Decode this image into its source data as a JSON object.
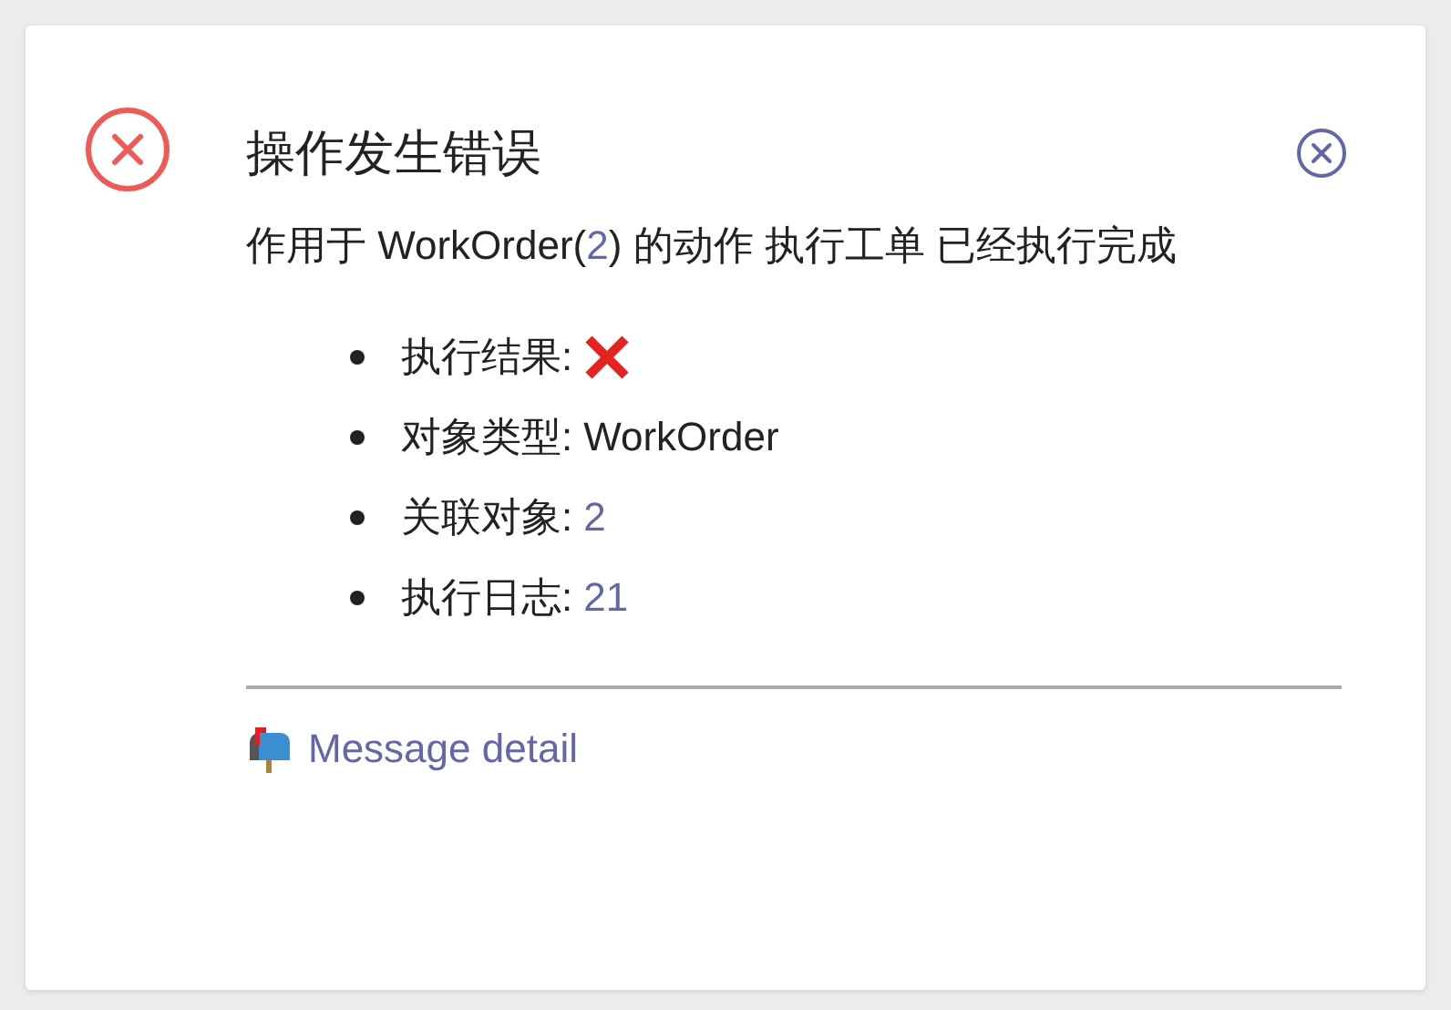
{
  "notification": {
    "title": "操作发生错误",
    "message": [
      {
        "kind": "text",
        "text": "作用于 WorkOrder("
      },
      {
        "kind": "link",
        "text": "2"
      },
      {
        "kind": "text",
        "text": ") 的动作 执行工单 已经执行完成"
      }
    ],
    "details": [
      {
        "label": "执行结果:",
        "kind": "icon"
      },
      {
        "label": "对象类型:",
        "kind": "text",
        "value": "WorkOrder"
      },
      {
        "label": "关联对象:",
        "kind": "link",
        "value": "2"
      },
      {
        "label": "执行日志:",
        "kind": "link",
        "value": "21"
      }
    ],
    "footer_link": "Message detail"
  }
}
